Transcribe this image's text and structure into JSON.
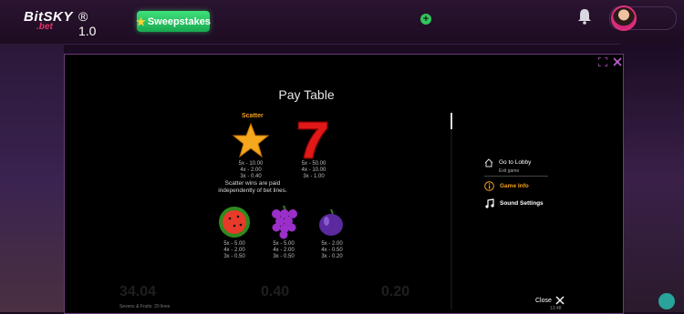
{
  "header": {
    "logo_main": "BitSKY",
    "logo_sub": ".bet",
    "logo_version": "® 1.0",
    "sweepstakes_label": "Sweepstakes",
    "add_label": "+"
  },
  "modal": {
    "title": "Pay Table",
    "scatter_label": "Scatter",
    "scatter_note": "Scatter wins are paid independently of bet lines.",
    "symbols": [
      {
        "name": "star",
        "pays": [
          "5x - 10.00",
          "4x - 2.00",
          "3x - 0.40"
        ]
      },
      {
        "name": "seven",
        "pays": [
          "5x - 50.00",
          "4x - 10.00",
          "3x - 1.00"
        ]
      },
      {
        "name": "watermelon",
        "pays": [
          "5x - 5.00",
          "4x - 2.00",
          "3x - 0.50"
        ]
      },
      {
        "name": "grapes",
        "pays": [
          "5x - 5.00",
          "4x - 2.00",
          "3x - 0.50"
        ]
      },
      {
        "name": "plum",
        "pays": [
          "5x - 2.00",
          "4x - 0.50",
          "3x - 0.20"
        ]
      }
    ],
    "menu": {
      "lobby_label": "Go to Lobby",
      "lobby_sub": "Exit game",
      "info_label": "Game Info",
      "sound_label": "Sound Settings"
    },
    "close_label": "Close",
    "time": "13:48",
    "footer": "Sevens & Fruits: 20 lines",
    "bg_values": [
      "34.04",
      "0.40",
      "0.20"
    ]
  },
  "colors": {
    "accent": "#f0a01a",
    "modal_border": "#6b3a7a",
    "sweep_green": "#2ecc6a"
  }
}
